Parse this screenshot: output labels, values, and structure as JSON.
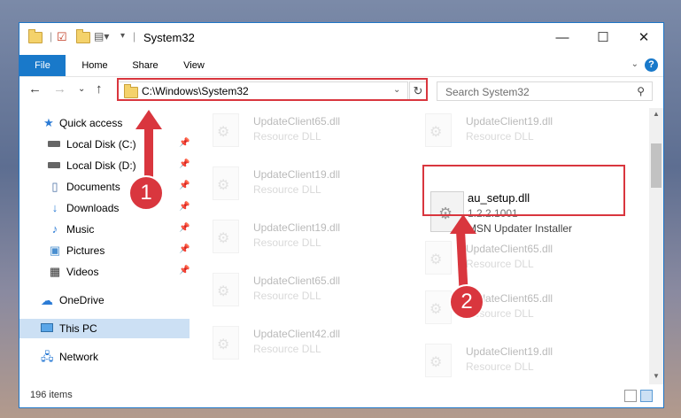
{
  "window": {
    "title": "System32",
    "controls": {
      "minimize": "—",
      "maximize": "☐",
      "close": "✕"
    }
  },
  "ribbon": {
    "tabs": [
      "File",
      "Home",
      "Share",
      "View"
    ],
    "help": "?"
  },
  "navbar": {
    "address": "C:\\Windows\\System32",
    "search_placeholder": "Search System32"
  },
  "sidebar": {
    "items": [
      {
        "label": "Quick access",
        "icon": "star-icon",
        "pinned": false
      },
      {
        "label": "Local Disk (C:)",
        "icon": "drive-icon",
        "pinned": true
      },
      {
        "label": "Local Disk (D:)",
        "icon": "drive-icon",
        "pinned": true
      },
      {
        "label": "Documents",
        "icon": "documents-icon",
        "pinned": true
      },
      {
        "label": "Downloads",
        "icon": "download-icon",
        "pinned": true
      },
      {
        "label": "Music",
        "icon": "music-icon",
        "pinned": true
      },
      {
        "label": "Pictures",
        "icon": "pictures-icon",
        "pinned": true
      },
      {
        "label": "Videos",
        "icon": "videos-icon",
        "pinned": true
      },
      {
        "label": "OneDrive",
        "icon": "cloud-icon",
        "pinned": false
      },
      {
        "label": "This PC",
        "icon": "computer-icon",
        "pinned": false,
        "selected": true
      },
      {
        "label": "Network",
        "icon": "network-icon",
        "pinned": false
      }
    ]
  },
  "files": {
    "left": [
      {
        "name": "UpdateClient65.dll",
        "type": "Resource DLL"
      },
      {
        "name": "UpdateClient19.dll",
        "type": "Resource DLL"
      },
      {
        "name": "UpdateClient19.dll",
        "type": "Resource DLL"
      },
      {
        "name": "UpdateClient65.dll",
        "type": "Resource DLL"
      },
      {
        "name": "UpdateClient42.dll",
        "type": "Resource DLL"
      }
    ],
    "right": [
      {
        "name": "UpdateClient19.dll",
        "type": "Resource DLL"
      },
      {
        "name": "UpdateClient65.dll",
        "type": "Resource DLL"
      },
      {
        "name": "UpdateClient65.dll",
        "type": "Resource DLL"
      },
      {
        "name": "UpdateClient19.dll",
        "type": "Resource DLL"
      }
    ],
    "highlighted": {
      "name": "au_setup.dll",
      "version": "1.2.2.1001",
      "type": "MSN Updater Installer"
    }
  },
  "status": {
    "items": "196 items"
  },
  "callouts": [
    "1",
    "2"
  ],
  "colors": {
    "accent": "#1979ca",
    "highlight": "#d9363e"
  }
}
